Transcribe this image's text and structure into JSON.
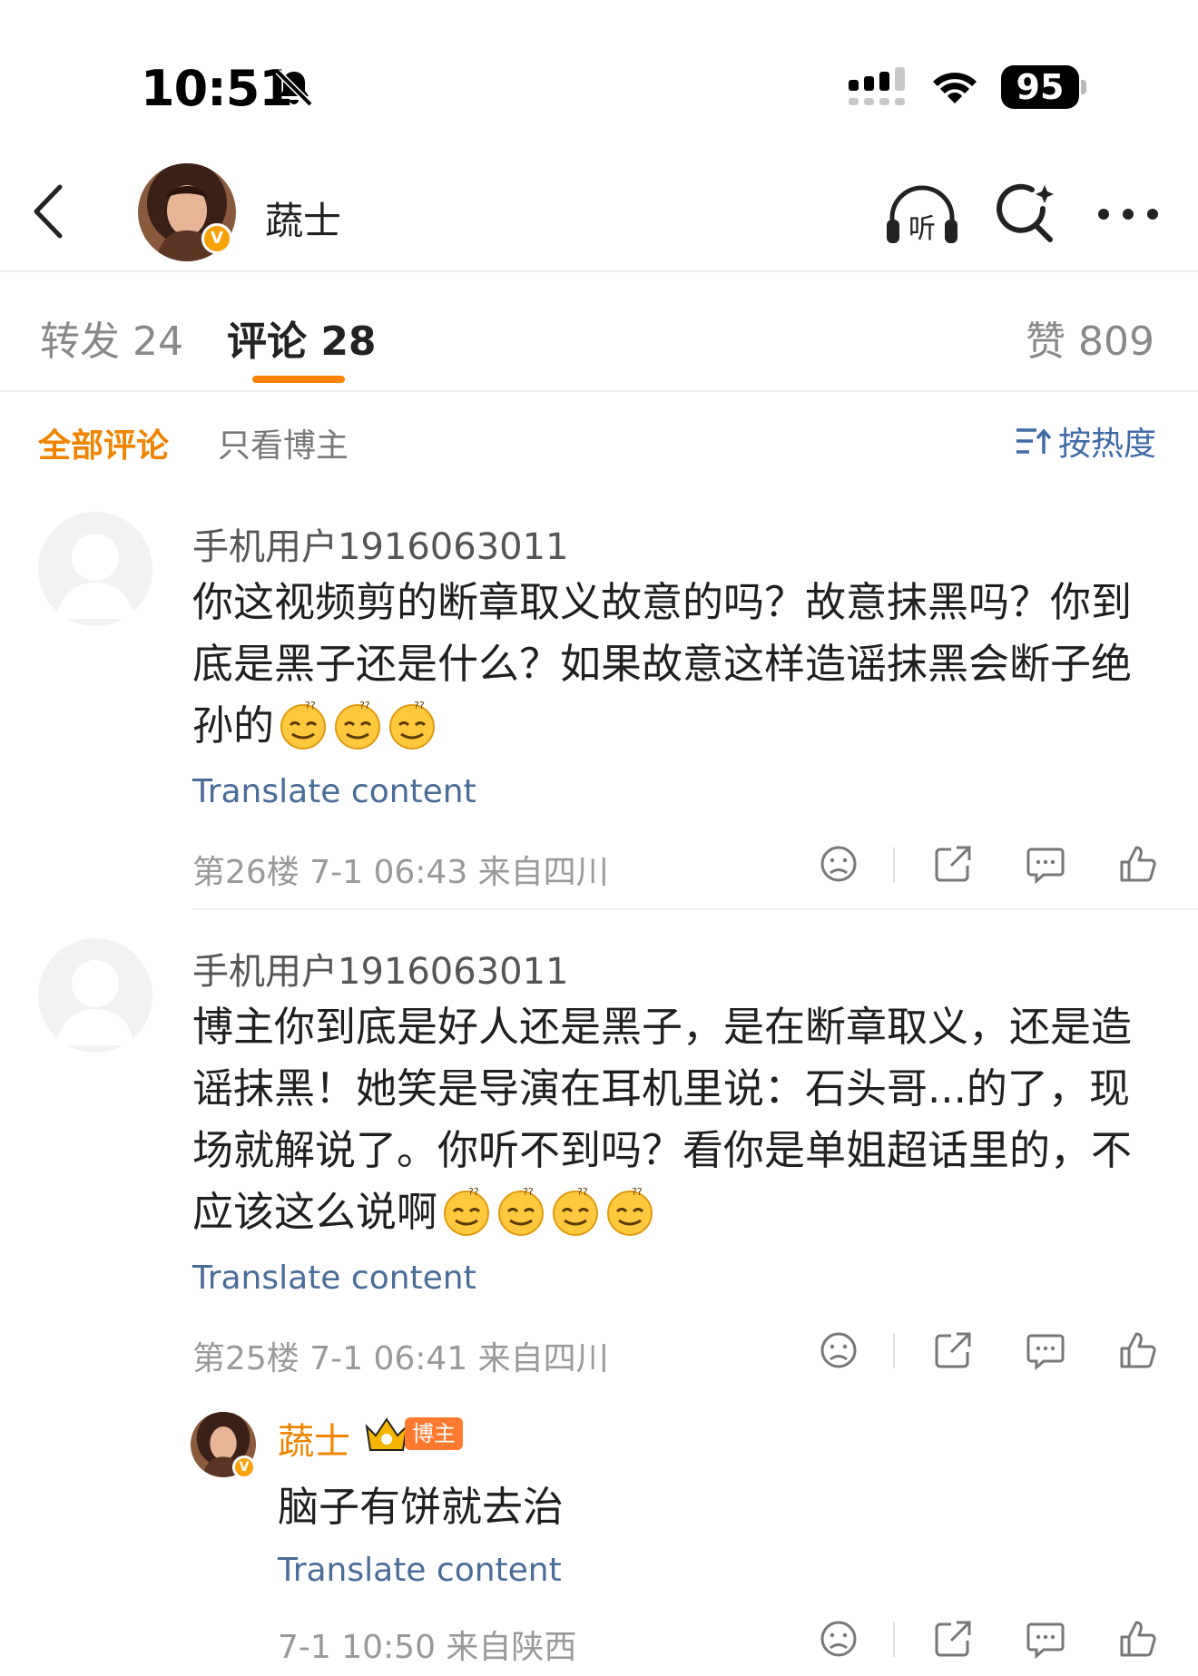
{
  "status_bar": {
    "time": "10:51",
    "battery": "95",
    "icons": [
      "bell-off-icon",
      "signal-icon",
      "wifi-icon",
      "battery-icon"
    ]
  },
  "nav": {
    "title": "蔬士",
    "verified_badge": "V",
    "icons": [
      "back-icon",
      "listen-icon",
      "search-icon",
      "more-icon"
    ],
    "listen_label": "听"
  },
  "tabs": {
    "repost": "转发 24",
    "comments": "评论 28",
    "likes": "赞 809",
    "active_color": "#ff8200"
  },
  "filters": {
    "all": "全部评论",
    "author_only": "只看博主",
    "sort": "按热度"
  },
  "comments": [
    {
      "user": "手机用户1916063011",
      "text": "你这视频剪的断章取义故意的吗？故意抹黑吗？你到底是黑子还是什么？如果故意这样造谣抹黑会断子绝孙的",
      "emoji_count": 3,
      "emoji_name": "dizzy-face-emoji",
      "translate": "Translate content",
      "meta": "第26楼 7-1 06:43 来自四川"
    },
    {
      "user": "手机用户1916063011",
      "text": "博主你到底是好人还是黑子，是在断章取义，还是造谣抹黑！她笑是导演在耳机里说：石头哥...的了，现场就解说了。你听不到吗？看你是单姐超话里的，不应该这么说啊",
      "emoji_count": 4,
      "emoji_name": "dizzy-face-emoji",
      "translate": "Translate content",
      "meta": "第25楼 7-1 06:41 来自四川"
    }
  ],
  "reply": {
    "user": "蔬士",
    "badge": "博主",
    "text": "脑子有饼就去治",
    "translate": "Translate content",
    "meta": "7-1 10:50 来自陕西"
  },
  "action_icons": [
    "dislike-icon",
    "share-icon",
    "comment-icon",
    "like-icon"
  ]
}
